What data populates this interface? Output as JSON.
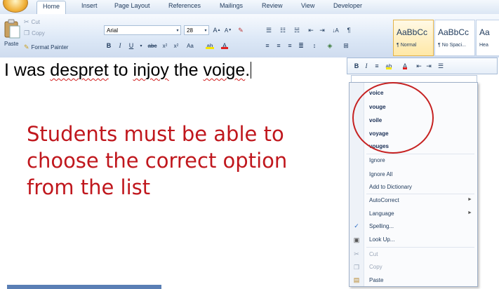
{
  "ribbon": {
    "tabs": [
      "Home",
      "Insert",
      "Page Layout",
      "References",
      "Mailings",
      "Review",
      "View",
      "Developer"
    ],
    "clipboard": {
      "paste": "Paste",
      "cut": "Cut",
      "copy": "Copy",
      "format_painter": "Format Painter"
    },
    "font": {
      "name": "Arial",
      "size": "28"
    },
    "styles": [
      {
        "sample": "AaBbCc",
        "name": "¶ Normal"
      },
      {
        "sample": "AaBbCc",
        "name": "¶ No Spaci..."
      },
      {
        "sample": "Aa",
        "name": "Hea"
      }
    ]
  },
  "document": {
    "line_before": "I was ",
    "word1": "despret",
    "line_mid": " to ",
    "word2": "injoy",
    "line_mid2": " the ",
    "word3": "voige",
    "line_end": ".",
    "note": "Students must be able to choose the correct option from the list"
  },
  "context_menu": {
    "suggestions": [
      "voice",
      "vouge",
      "voile",
      "voyage",
      "vouges"
    ],
    "items": [
      {
        "label": "Ignore"
      },
      {
        "label": "Ignore All"
      },
      {
        "label": "Add to Dictionary"
      },
      {
        "label": "AutoCorrect",
        "submenu": "►"
      },
      {
        "label": "Language",
        "submenu": "►"
      },
      {
        "label": "Spelling..."
      },
      {
        "label": "Look Up..."
      },
      {
        "label": "Cut"
      },
      {
        "label": "Copy"
      },
      {
        "label": "Paste"
      }
    ]
  },
  "colors": {
    "annotation_red": "#c0171d",
    "circle_red": "#c62222",
    "accent_blue": "#1e395b"
  }
}
